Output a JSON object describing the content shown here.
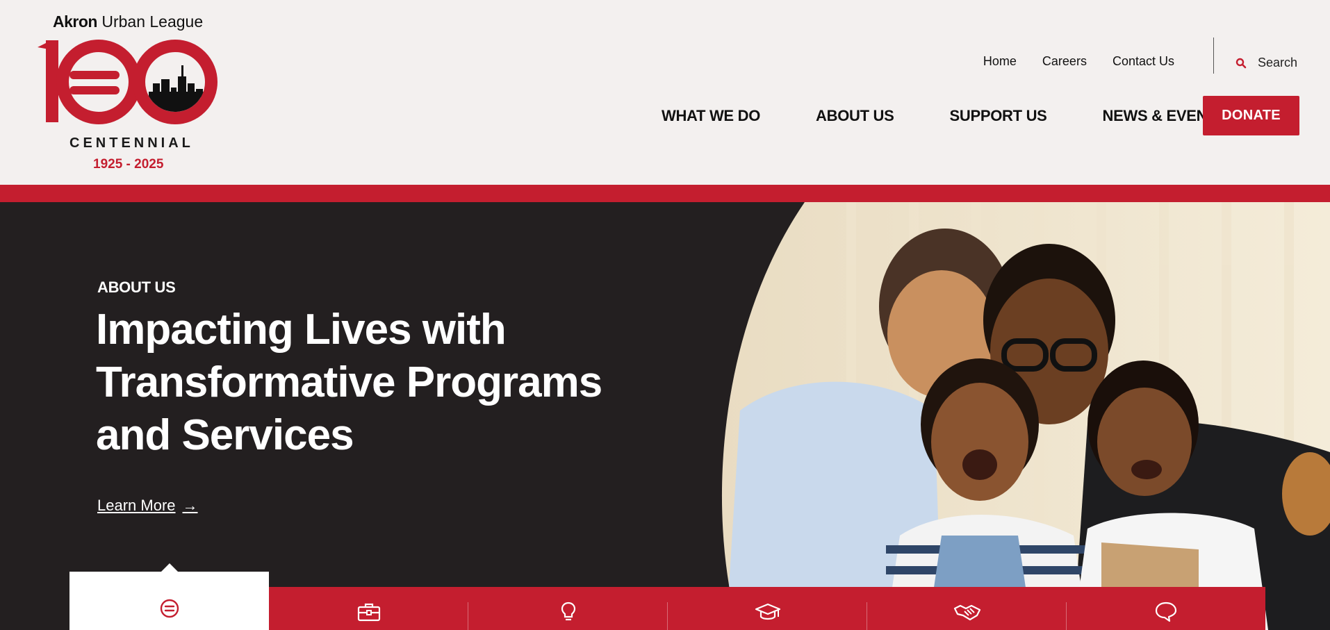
{
  "logo": {
    "org_bold": "Akron",
    "org_rest": "Urban League",
    "centennial": "CENTENNIAL",
    "years": "1925 - 2025"
  },
  "utility_nav": [
    "Home",
    "Careers",
    "Contact Us"
  ],
  "search": {
    "label": "Search"
  },
  "main_nav": [
    "WHAT WE DO",
    "ABOUT US",
    "SUPPORT US",
    "NEWS & EVENTS"
  ],
  "donate": "DONATE",
  "hero": {
    "eyebrow": "ABOUT US",
    "title": "Impacting Lives with Transformative Programs and Services",
    "link": "Learn More",
    "link_arrow": "→"
  },
  "tabs": {
    "icons": [
      "equal-circle-icon",
      "briefcase-icon",
      "lightbulb-icon",
      "graduation-cap-icon",
      "handshake-icon",
      "speech-bubble-icon"
    ],
    "active_index": 0
  },
  "colors": {
    "brand_red": "#c41e2f",
    "header_bg": "#f3f0ef",
    "hero_bg": "#231f20"
  }
}
